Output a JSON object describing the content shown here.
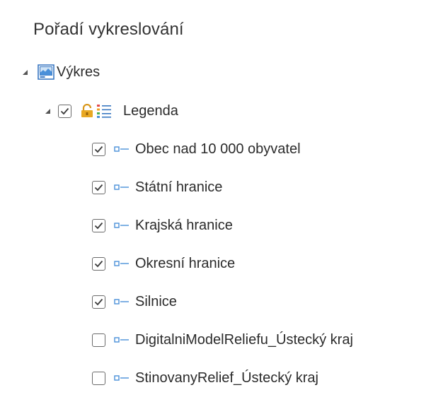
{
  "panel": {
    "title": "Pořadí vykreslování"
  },
  "map": {
    "label": "Výkres",
    "expanded": true,
    "icon": "map-icon"
  },
  "group": {
    "label": "Legenda",
    "expanded": true,
    "checked": true,
    "icons": [
      "lock-icon",
      "list-icon"
    ]
  },
  "layers": [
    {
      "label": "Obec nad 10 000 obyvatel",
      "checked": true
    },
    {
      "label": "Státní hranice",
      "checked": true
    },
    {
      "label": "Krajská hranice",
      "checked": true
    },
    {
      "label": "Okresní hranice",
      "checked": true
    },
    {
      "label": "Silnice",
      "checked": true
    },
    {
      "label": "DigitalniModelReliefu_Ústecký kraj",
      "checked": false
    },
    {
      "label": "StinovanyRelief_Ústecký kraj",
      "checked": false
    }
  ],
  "colors": {
    "accent": "#4a90d9",
    "lock": "#d9981c",
    "text": "#2b2b2b"
  }
}
